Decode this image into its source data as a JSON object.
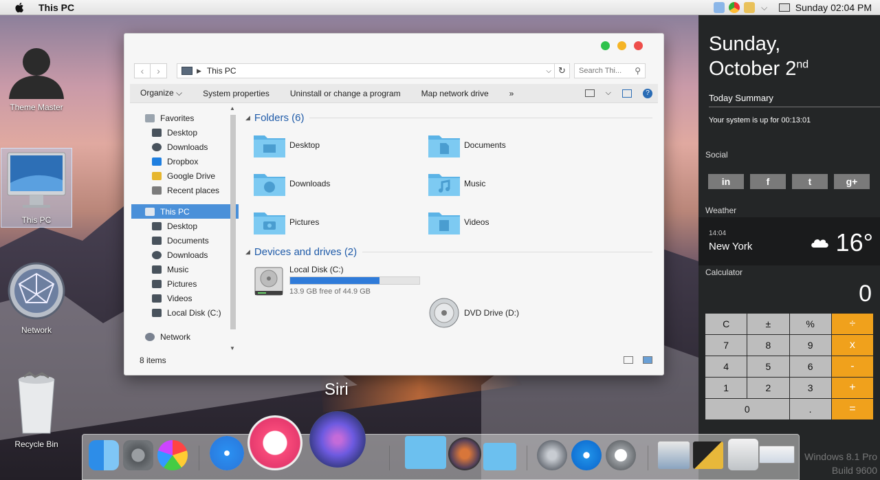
{
  "menubar": {
    "app_title": "This PC",
    "clock": "Sunday 02:04 PM"
  },
  "desktop": {
    "icons": [
      "Theme Master",
      "This PC",
      "Network",
      "Recycle Bin"
    ]
  },
  "explorer": {
    "address": "This PC",
    "search_placeholder": "Search Thi...",
    "commands": [
      "Organize ⌵",
      "System properties",
      "Uninstall or change a program",
      "Map network drive",
      "»"
    ],
    "nav": {
      "favorites_label": "Favorites",
      "favorites": [
        "Desktop",
        "Downloads",
        "Dropbox",
        "Google Drive",
        "Recent places"
      ],
      "thispc_label": "This PC",
      "thispc": [
        "Desktop",
        "Documents",
        "Downloads",
        "Music",
        "Pictures",
        "Videos",
        "Local Disk (C:)"
      ],
      "network_label": "Network"
    },
    "folders_header": "Folders (6)",
    "folders": [
      "Desktop",
      "Documents",
      "Downloads",
      "Music",
      "Pictures",
      "Videos"
    ],
    "drives_header": "Devices and drives (2)",
    "drive_c": {
      "name": "Local Disk (C:)",
      "free": "13.9 GB free of 44.9 GB",
      "used_fraction": 0.69
    },
    "drive_d": {
      "name": "DVD Drive (D:)"
    },
    "status": "8 items"
  },
  "panel": {
    "day": "Sunday,",
    "date": "October 2",
    "date_suffix": "nd",
    "summary_title": "Today Summary",
    "summary_text": "Your system is up for 00:13:01",
    "social_label": "Social",
    "social_buttons": [
      "in",
      "f",
      "t",
      "g+"
    ],
    "weather_label": "Weather",
    "weather_time": "14:04",
    "weather_city": "New York",
    "weather_temp": "16°",
    "calculator_label": "Calculator",
    "calc_display": "0",
    "calc_keys": [
      "C",
      "±",
      "%",
      "÷",
      "7",
      "8",
      "9",
      "x",
      "4",
      "5",
      "6",
      "-",
      "1",
      "2",
      "3",
      "+",
      "0",
      ".",
      "="
    ]
  },
  "dock": {
    "siri_label": "Siri"
  },
  "watermark": {
    "line1": "Windows 8.1 Pro",
    "line2": "Build 9600"
  },
  "colors": {
    "accent": "#4a90d9",
    "calc_orange": "#f0a11c",
    "folder_blue": "#6cc0ef"
  }
}
